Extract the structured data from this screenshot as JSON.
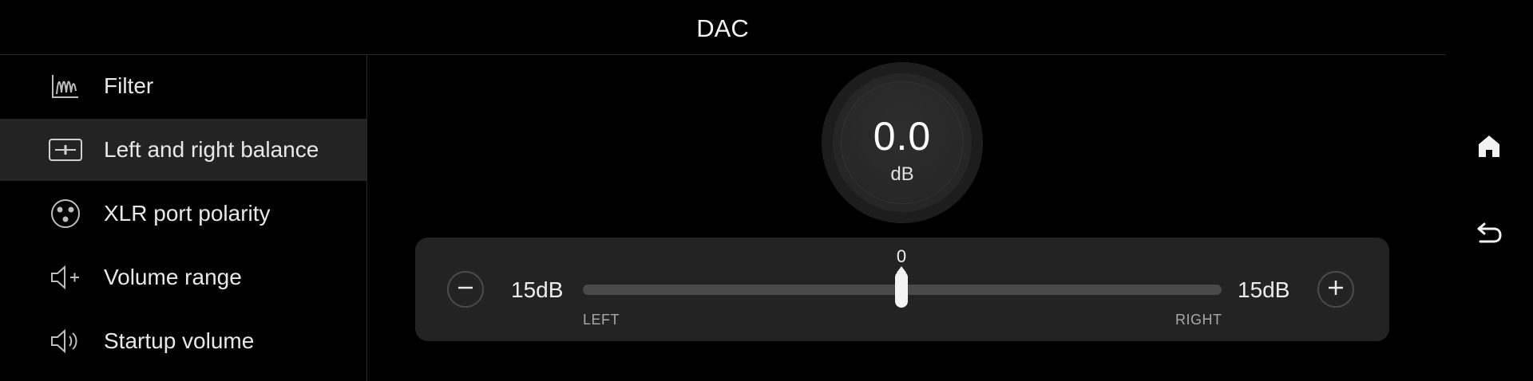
{
  "header": {
    "title": "DAC"
  },
  "sidebar": {
    "items": [
      {
        "label": "Filter",
        "icon": "filter-wave-icon",
        "active": false
      },
      {
        "label": "Left and right balance",
        "icon": "balance-icon",
        "active": true
      },
      {
        "label": "XLR port polarity",
        "icon": "xlr-port-icon",
        "active": false
      },
      {
        "label": "Volume range",
        "icon": "volume-plus-icon",
        "active": false
      },
      {
        "label": "Startup volume",
        "icon": "speaker-icon",
        "active": false
      }
    ]
  },
  "balance": {
    "value": "0.0",
    "unit": "dB",
    "slider_value": "0",
    "slider_position_fraction": 0.5,
    "left_max": "15dB",
    "right_max": "15dB",
    "left_label": "LEFT",
    "right_label": "RIGHT"
  },
  "nav": {
    "home_icon": "home-icon",
    "back_icon": "back-icon"
  },
  "colors": {
    "background": "#000000",
    "panel": "#232323",
    "active_row": "#232323",
    "track": "#4a4a4a"
  }
}
